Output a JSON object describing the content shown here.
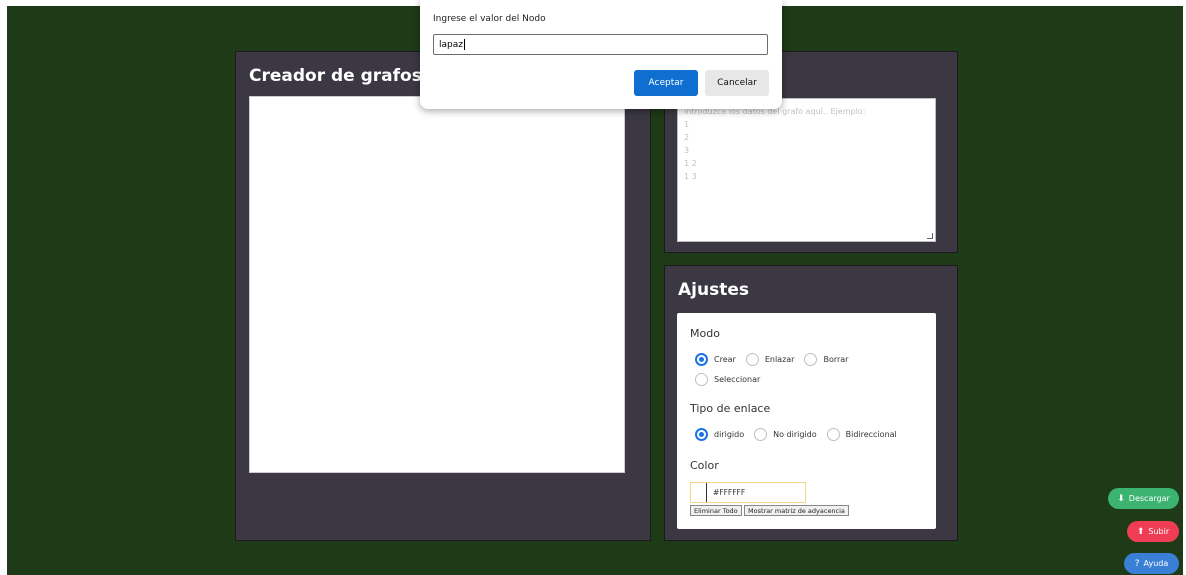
{
  "panels": {
    "creator_title": "Creador de grafos",
    "settings_title": "Ajustes"
  },
  "data_input": {
    "placeholder_lines": [
      "Introduzca los datos del grafo aquí.. Ejemplo:",
      "1",
      "2",
      "3",
      "1 2",
      "1 3"
    ]
  },
  "settings": {
    "mode_label": "Modo",
    "modes": [
      "Crear",
      "Enlazar",
      "Borrar",
      "Seleccionar"
    ],
    "mode_selected": "Crear",
    "link_type_label": "Tipo de enlace",
    "link_types": [
      "dirigido",
      "No dirigido",
      "Bidireccional"
    ],
    "link_type_selected": "dirigido",
    "color_label": "Color",
    "color_value": "#FFFFFF",
    "delete_all_label": "Eliminar Todo",
    "show_matrix_label": "Mostrar matriz de adyacencia"
  },
  "floating_buttons": {
    "download": "Descargar",
    "upload": "Subir",
    "help": "Ayuda"
  },
  "dialog": {
    "message": "Ingrese el valor del Nodo",
    "input_value": "lapaz",
    "ok_label": "Aceptar",
    "cancel_label": "Cancelar"
  },
  "colors": {
    "background": "#1e3a16",
    "panel": "#3b3843",
    "accent_blue": "#0f6fd1",
    "download_green": "#3cb371",
    "upload_red": "#ef3d55",
    "help_blue": "#3a7fd6"
  }
}
